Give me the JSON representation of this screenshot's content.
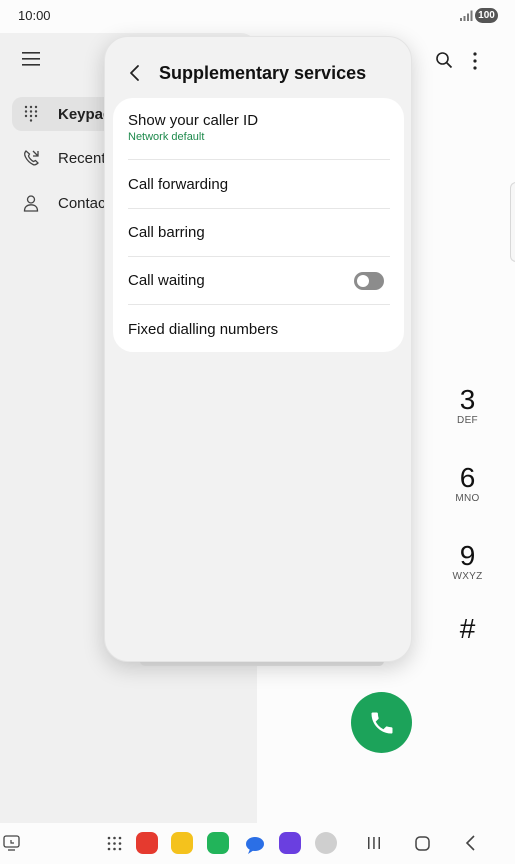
{
  "status_bar": {
    "time": "10:00",
    "battery": "100"
  },
  "sidebar": {
    "items": [
      {
        "label": "Keypad",
        "icon": "keypad-icon",
        "selected": true
      },
      {
        "label": "Recents",
        "icon": "recents-icon",
        "selected": false
      },
      {
        "label": "Contacts",
        "icon": "contacts-icon",
        "selected": false
      }
    ]
  },
  "dialpad": {
    "keys": [
      {
        "digit": "3",
        "letters": "DEF"
      },
      {
        "digit": "6",
        "letters": "MNO"
      },
      {
        "digit": "9",
        "letters": "WXYZ"
      },
      {
        "digit": "#",
        "letters": ""
      }
    ]
  },
  "popup": {
    "title": "Supplementary services",
    "rows": [
      {
        "title": "Show your caller ID",
        "subtitle": "Network default"
      },
      {
        "title": "Call forwarding"
      },
      {
        "title": "Call barring"
      },
      {
        "title": "Call waiting",
        "toggle": false
      },
      {
        "title": "Fixed dialling numbers"
      }
    ]
  },
  "colors": {
    "accent_green": "#1ca35a",
    "subtitle_green": "#1e8a4c"
  }
}
